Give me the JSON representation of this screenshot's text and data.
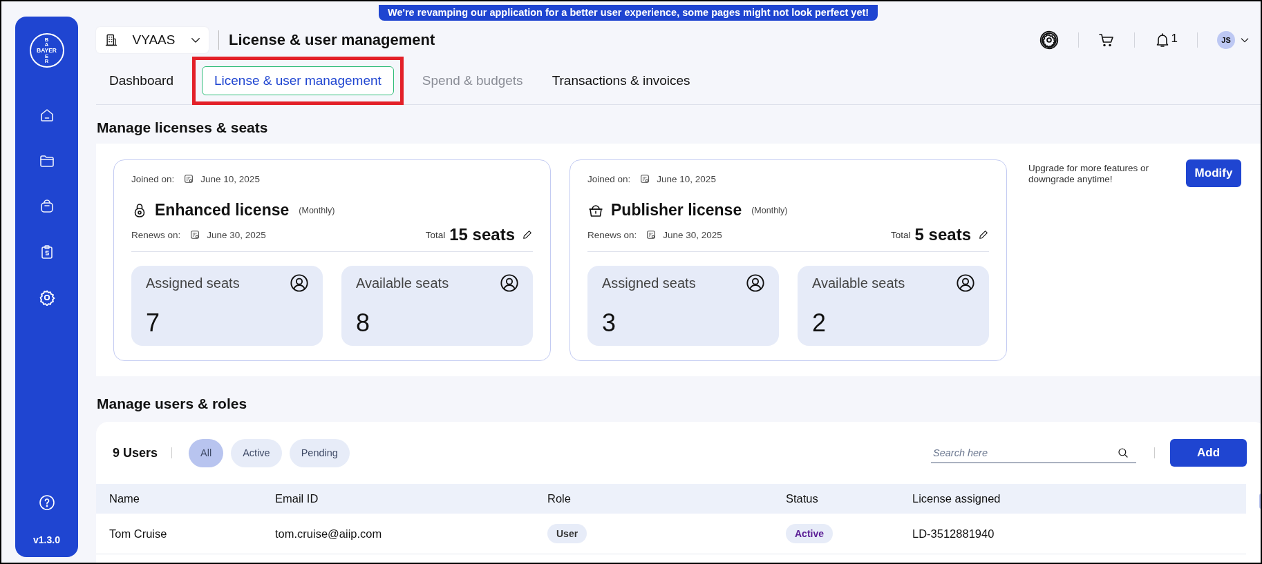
{
  "banner": {
    "text": "We're revamping our application for a better user experience, some pages might not look perfect yet!"
  },
  "sidebar": {
    "logo": {
      "top": "BA",
      "horizontal": "BAYER",
      "bottom": "ER"
    },
    "items": [
      {
        "kind": "home",
        "selected": false
      },
      {
        "kind": "folder",
        "selected": false
      },
      {
        "kind": "bag",
        "selected": false
      },
      {
        "kind": "clipboard",
        "selected": false
      },
      {
        "kind": "settings",
        "selected": true
      }
    ],
    "version": "v1.3.0"
  },
  "header": {
    "org": "VYAAS",
    "title": "License & user management",
    "notifications": "1",
    "avatar": "JS"
  },
  "tabs": [
    {
      "label": "Dashboard",
      "selected": false,
      "disabled": false,
      "highlighted": false
    },
    {
      "label": "License & user management",
      "selected": true,
      "disabled": false,
      "highlighted": true
    },
    {
      "label": "Spend & budgets",
      "selected": false,
      "disabled": true,
      "highlighted": false
    },
    {
      "label": "Transactions & invoices",
      "selected": false,
      "disabled": false,
      "highlighted": false
    }
  ],
  "licenses": {
    "title": "Manage licenses & seats",
    "cards": [
      {
        "kind": "enhanced",
        "joined_label": "Joined on:",
        "joined_date": "June 10, 2025",
        "name": "Enhanced license",
        "period": "(Monthly)",
        "renews_label": "Renews on:",
        "renews_date": "June 30, 2025",
        "total_label": "Total",
        "total": "15 seats",
        "stats": [
          {
            "label": "Assigned seats",
            "value": "7"
          },
          {
            "label": "Available seats",
            "value": "8"
          }
        ]
      },
      {
        "kind": "publisher",
        "joined_label": "Joined on:",
        "joined_date": "June 10, 2025",
        "name": "Publisher license",
        "period": "(Monthly)",
        "renews_label": "Renews on:",
        "renews_date": "June 30, 2025",
        "total_label": "Total",
        "total": "5 seats",
        "stats": [
          {
            "label": "Assigned seats",
            "value": "3"
          },
          {
            "label": "Available seats",
            "value": "2"
          }
        ]
      }
    ],
    "upgrade": {
      "text": "Upgrade for more features or downgrade anytime!",
      "button": "Modify"
    }
  },
  "users": {
    "title": "Manage users & roles",
    "count": "9 Users",
    "filters": [
      {
        "label": "All",
        "selected": true
      },
      {
        "label": "Active",
        "selected": false
      },
      {
        "label": "Pending",
        "selected": false
      }
    ],
    "search": {
      "placeholder": "Search here"
    },
    "add_button": "Add",
    "table": {
      "columns": [
        "Name",
        "Email ID",
        "Role",
        "Status",
        "License assigned"
      ],
      "rows": [
        {
          "name": "Tom Cruise",
          "email": "tom.cruise@aiip.com",
          "role": "User",
          "status": "Active",
          "license": "LD-3512881940"
        }
      ]
    }
  }
}
